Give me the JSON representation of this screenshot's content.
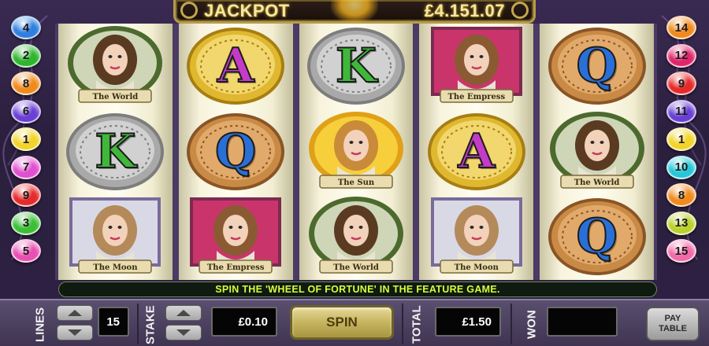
{
  "jackpot": {
    "label": "JACKPOT",
    "value": "£4.151.07"
  },
  "left_lines": [
    {
      "label": "4",
      "color": "#2f7fe0"
    },
    {
      "label": "2",
      "color": "#2fb52f"
    },
    {
      "label": "8",
      "color": "#f08a1e"
    },
    {
      "label": "6",
      "color": "#6a3fd6"
    },
    {
      "label": "1",
      "color": "#f2d42a"
    },
    {
      "label": "7",
      "color": "#e04fd0"
    },
    {
      "label": "9",
      "color": "#e62a2a"
    },
    {
      "label": "3",
      "color": "#3cbf36"
    },
    {
      "label": "5",
      "color": "#e84fb2"
    }
  ],
  "right_lines": [
    {
      "label": "14",
      "color": "#f08a1e"
    },
    {
      "label": "12",
      "color": "#e0266a"
    },
    {
      "label": "9",
      "color": "#e62a2a"
    },
    {
      "label": "11",
      "color": "#6a3fd6"
    },
    {
      "label": "1",
      "color": "#f2d42a"
    },
    {
      "label": "10",
      "color": "#27c7d8"
    },
    {
      "label": "8",
      "color": "#f08a1e"
    },
    {
      "label": "13",
      "color": "#b9d12a"
    },
    {
      "label": "15",
      "color": "#f26aa8"
    }
  ],
  "reels": [
    [
      {
        "kind": "card",
        "label": "The World",
        "scene": "world"
      },
      {
        "kind": "coin",
        "letter": "K",
        "coin": "silver"
      },
      {
        "kind": "card",
        "label": "The Moon",
        "scene": "moon"
      }
    ],
    [
      {
        "kind": "coin",
        "letter": "A",
        "coin": "gold"
      },
      {
        "kind": "coin",
        "letter": "Q",
        "coin": "bronze"
      },
      {
        "kind": "card",
        "label": "The Empress",
        "scene": "empress"
      }
    ],
    [
      {
        "kind": "coin",
        "letter": "K",
        "coin": "silver"
      },
      {
        "kind": "card",
        "label": "The Sun",
        "scene": "sun"
      },
      {
        "kind": "card",
        "label": "The World",
        "scene": "world"
      }
    ],
    [
      {
        "kind": "card",
        "label": "The Empress",
        "scene": "empress"
      },
      {
        "kind": "coin",
        "letter": "A",
        "coin": "gold"
      },
      {
        "kind": "card",
        "label": "The Moon",
        "scene": "moon"
      }
    ],
    [
      {
        "kind": "coin",
        "letter": "Q",
        "coin": "bronze"
      },
      {
        "kind": "card",
        "label": "The World",
        "scene": "world"
      },
      {
        "kind": "coin",
        "letter": "Q",
        "coin": "bronze"
      }
    ]
  ],
  "message": "SPIN THE 'WHEEL OF FORTUNE' IN THE FEATURE GAME.",
  "panel": {
    "lines_label": "LINES",
    "lines_value": "15",
    "stake_label": "STAKE",
    "stake_value": "£0.10",
    "spin_label": "SPIN",
    "total_label": "TOTAL",
    "total_value": "£1.50",
    "won_label": "WON",
    "won_value": "",
    "paytable_line1": "PAY",
    "paytable_line2": "TABLE"
  },
  "colors": {
    "letter_A": "#c43bc8",
    "letter_K": "#3fb83a",
    "letter_Q": "#2a6fd6",
    "message_text": "#d9ff3a"
  }
}
